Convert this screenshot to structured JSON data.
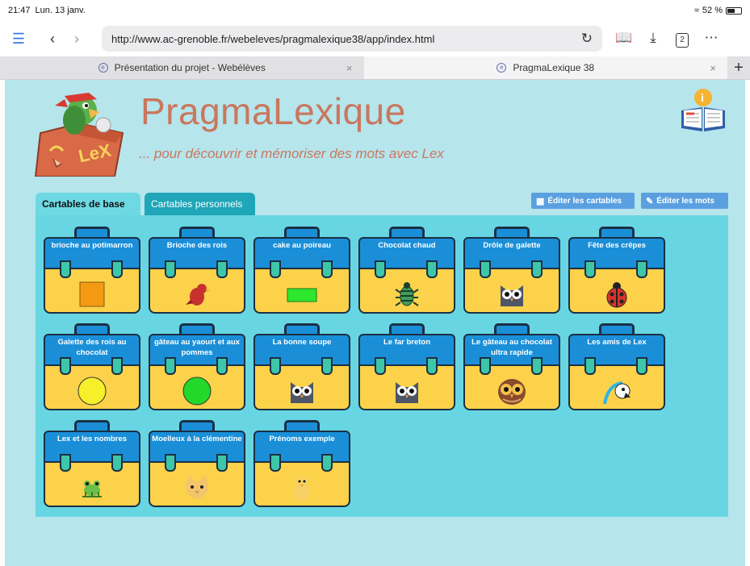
{
  "status": {
    "time": "21:47",
    "date": "Lun. 13 janv.",
    "battery": "52 %"
  },
  "toolbar": {
    "url": "http://www.ac-grenoble.fr/webeleves/pragmalexique38/app/index.html",
    "tab_count": "2"
  },
  "browser_tabs": [
    {
      "title": "Présentation du projet - Webélèves"
    },
    {
      "title": "PragmaLexique 38"
    }
  ],
  "app": {
    "title": "PragmaLexique",
    "subtitle": "... pour découvrir et mémoriser des mots avec Lex",
    "tab_base": "Cartables de base",
    "tab_perso": "Cartables personnels",
    "edit_cartables": "Éditer les cartables",
    "edit_mots": "Éditer les mots"
  },
  "bags": [
    {
      "label": "brioche au potimarron",
      "icon": "orange-square-icon"
    },
    {
      "label": "Brioche des rois",
      "icon": "red-bird-icon"
    },
    {
      "label": "cake au poireau",
      "icon": "green-rectangle-icon"
    },
    {
      "label": "Chocolat chaud",
      "icon": "bug-icon"
    },
    {
      "label": "Drôle de galette",
      "icon": "owl-icon"
    },
    {
      "label": "Fête des crêpes",
      "icon": "ladybug-icon"
    },
    {
      "label": "Galette des rois au chocolat",
      "icon": "yellow-circle-icon"
    },
    {
      "label": "gâteau au yaourt et aux pommes",
      "icon": "green-circle-icon"
    },
    {
      "label": "La bonne soupe",
      "icon": "owl-icon"
    },
    {
      "label": "Le far breton",
      "icon": "owl-icon"
    },
    {
      "label": "Le gâteau au chocolat ultra rapide",
      "icon": "brown-owl-icon"
    },
    {
      "label": "Les amis de Lex",
      "icon": "parrot-icon"
    },
    {
      "label": "Lex et les nombres",
      "icon": "frog-icon"
    },
    {
      "label": "Moelleux à la clémentine",
      "icon": "cat-icon"
    },
    {
      "label": "Prénoms exemple",
      "icon": "chick-icon"
    }
  ],
  "colors": {
    "page_bg": "#b6e5ec",
    "panel_bg": "#67d6e2",
    "title": "#c9775e",
    "bag_flap": "#1a8fd8",
    "bag_body": "#fbd24a"
  }
}
